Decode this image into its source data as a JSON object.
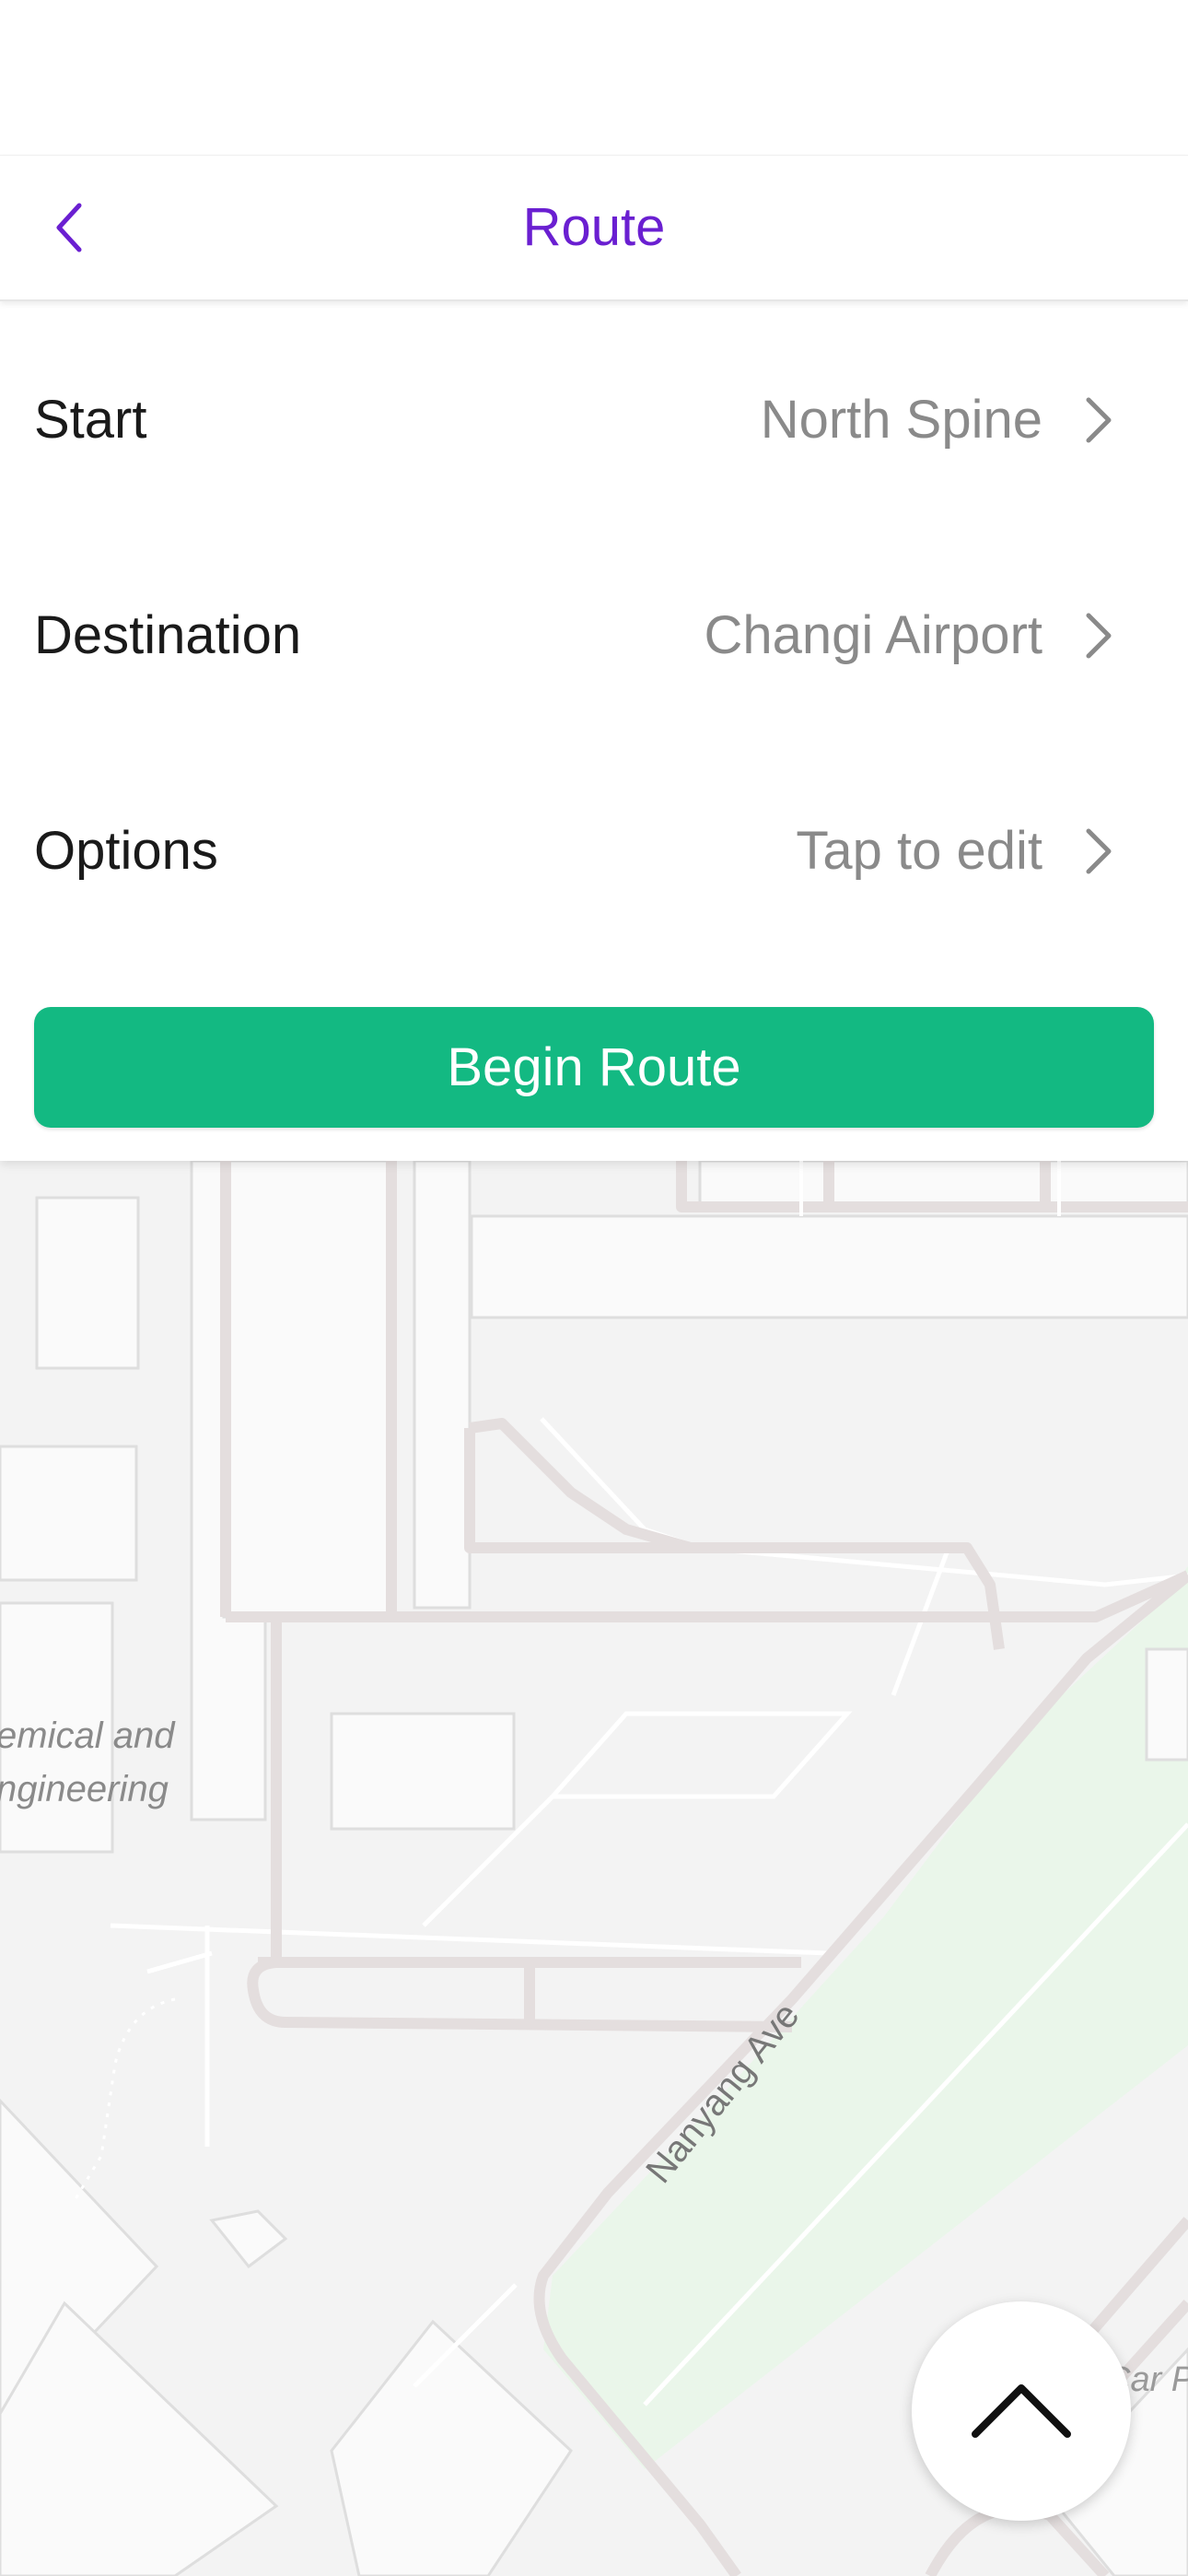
{
  "nav": {
    "title": "Route",
    "back_icon": "chevron-left-icon",
    "accent_color": "#6a1fd1"
  },
  "route": {
    "start": {
      "label": "Start",
      "value": "North Spine"
    },
    "destination": {
      "label": "Destination",
      "value": "Changi Airport"
    },
    "options": {
      "label": "Options",
      "value": "Tap to edit"
    },
    "chevron_icon": "chevron-right-icon"
  },
  "begin_button": {
    "label": "Begin Route",
    "color": "#13b982"
  },
  "map": {
    "street_label": "Nanyang Ave",
    "building_label_line1": "emical and",
    "building_label_line2": "ngineering",
    "carpark_label": "Car P",
    "park_color": "#eaf6ea"
  },
  "fab": {
    "icon": "chevron-up-icon"
  }
}
